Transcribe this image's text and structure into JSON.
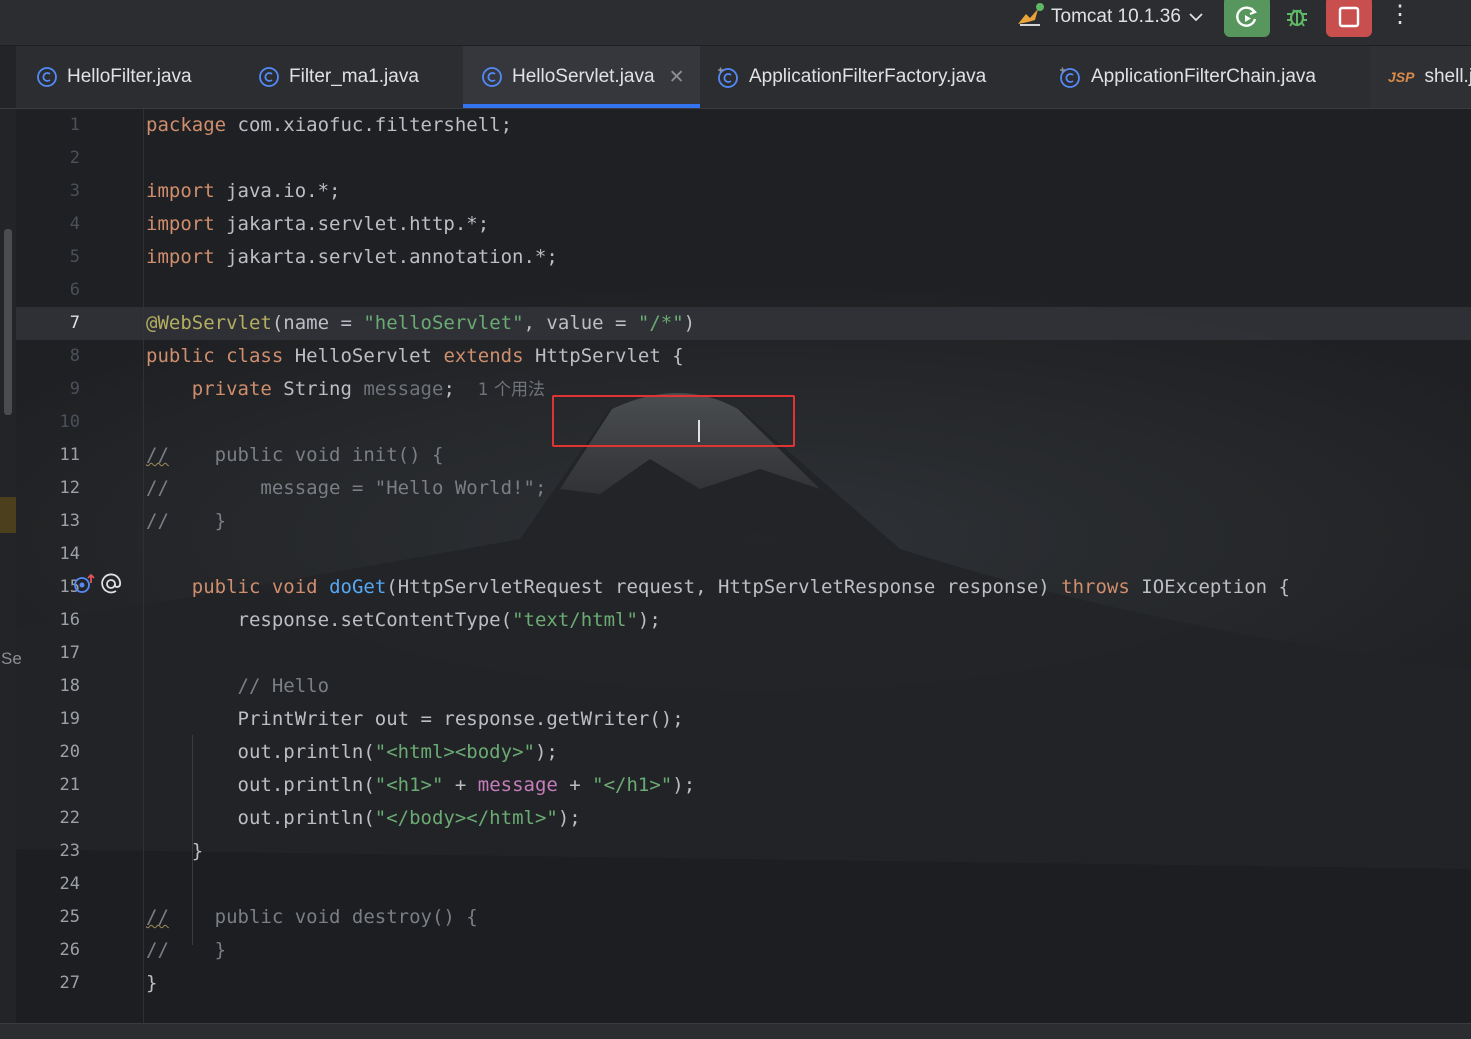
{
  "run_config": {
    "label": "Tomcat 10.1.36"
  },
  "tabs": [
    {
      "label": "HelloFilter.java",
      "icon": "class-icon"
    },
    {
      "label": "Filter_ma1.java",
      "icon": "class-icon"
    },
    {
      "label": "HelloServlet.java",
      "icon": "class-icon",
      "active": true,
      "close": "✕"
    },
    {
      "label": "ApplicationFilterFactory.java",
      "icon": "library-class-icon"
    },
    {
      "label": "ApplicationFilterChain.java",
      "icon": "library-class-icon"
    },
    {
      "label": "shell.js",
      "icon": "jsp-icon",
      "icon_text": "JSP"
    }
  ],
  "sidebar_hint": "Se",
  "editor": {
    "current_line": 7,
    "line_numbers": [
      "1",
      "2",
      "3",
      "4",
      "5",
      "6",
      "7",
      "8",
      "9",
      "10",
      "11",
      "12",
      "13",
      "14",
      "15",
      "16",
      "17",
      "18",
      "19",
      "20",
      "21",
      "22",
      "23",
      "24",
      "25",
      "26",
      "27"
    ],
    "tokens": {
      "l1_kw": "package",
      "l1_rest": " com.xiaofuc.filtershell;",
      "import": "import",
      "l3_rest": " java.io.*;",
      "l4_rest": " jakarta.servlet.http.*;",
      "l5_rest": " jakarta.servlet.annotation.*;",
      "l7_ann": "@WebServlet",
      "l7_a": "(name = ",
      "l7_s1": "\"helloServlet\"",
      "l7_b": ", value = ",
      "l7_s2": "\"/*\"",
      "l7_c": ")",
      "l8_kw1": "public class",
      "l8_a": " HelloServlet ",
      "l8_kw2": "extends",
      "l8_b": " HttpServlet {",
      "l9_kw": "private",
      "l9_a": " String ",
      "l9_field": "message",
      "l9_b": ";",
      "l9_hint": "1 个用法",
      "c_slashes": "//",
      "l11_rest": "    public void init() {",
      "l12_rest": "        message = \"Hello World!\";",
      "l13_rest": "    }",
      "l15_kw1": "public void",
      "l15_fn": "doGet",
      "l15_a": "(HttpServletRequest request, HttpServletResponse response) ",
      "l15_kw2": "throws",
      "l15_b": " IOException {",
      "l16_a": "response.setContentType(",
      "l16_s": "\"text/html\"",
      "l16_b": ");",
      "l18_cmt": "// Hello",
      "l19": "PrintWriter out = response.getWriter();",
      "l20_a": "out.println(",
      "l20_s": "\"<html><body>\"",
      "l20_b": ");",
      "l21_a": "out.println(",
      "l21_s1": "\"<h1>\"",
      "l21_b": " + ",
      "l21_f": "message",
      "l21_c": " + ",
      "l21_s2": "\"</h1>\"",
      "l21_d": ");",
      "l22_a": "out.println(",
      "l22_s": "\"</body></html>\"",
      "l22_b": ");",
      "l23": "}",
      "l25_rest": "    public void destroy() {",
      "l26_rest": "    }",
      "l27": "}"
    }
  }
}
